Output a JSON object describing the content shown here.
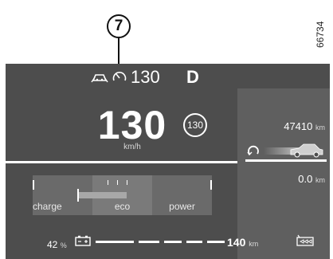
{
  "callout": {
    "number": "7"
  },
  "figure_id": "66734",
  "top_bar": {
    "speed_limit": "130",
    "gear": "D"
  },
  "speed": {
    "value": "130",
    "unit": "km/h"
  },
  "speed_limit_sign": "130",
  "odometer": {
    "value": "47410",
    "unit": "km"
  },
  "trip": {
    "value": "0.0",
    "unit": "km"
  },
  "power_meter": {
    "labels": {
      "charge": "charge",
      "eco": "eco",
      "power": "power"
    }
  },
  "battery": {
    "percent": "42",
    "unit": "%"
  },
  "range": {
    "value": "140",
    "unit": "km"
  },
  "colors": {
    "background": "#4d4d4d",
    "panel": "#5f5f5f",
    "text": "#ffffff"
  },
  "icons": [
    "driving-assist-icon",
    "speed-limiter-icon",
    "car-icon",
    "reset-icon",
    "battery-icon",
    "charging-cable-icon"
  ]
}
